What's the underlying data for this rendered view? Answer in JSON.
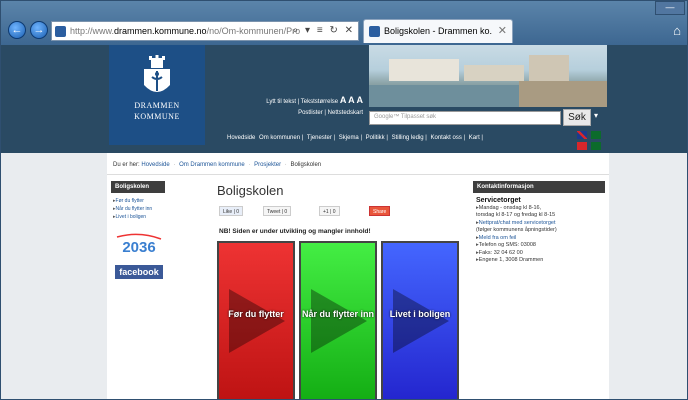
{
  "browser": {
    "url_prefix": "http://www.",
    "url_domain": "drammen.kommune.no",
    "url_rest": "/no/Om-kommunen/Pro",
    "address_tools": "⌕ ▾ ≡ ↻ ✕",
    "tab_title": "Boligskolen - Drammen ko...",
    "tab_close": "✕",
    "back_label": "←",
    "forward_label": "→",
    "home_label": "⌂",
    "window_btn": "—"
  },
  "header": {
    "logo_line1": "DRAMMEN",
    "logo_line2": "KOMMUNE",
    "util_line1_a": "Lytt til tekst | Tekststørrelse",
    "util_line1_b": "A A A",
    "util_line2": "Postlister | Nettstedskart",
    "search_placeholder": "Google™ Tilpasset søk",
    "search_button": "Søk",
    "search_dropdown": "▾",
    "nav": [
      "Hovedside",
      "Om kommunen |",
      "Tjenester |",
      "Skjema |",
      "Politikk |",
      "Stilling ledig |",
      "Kontakt oss |",
      "Kart |"
    ]
  },
  "breadcrumb": {
    "prefix": "Du er her:",
    "items": [
      "Hovedside",
      "Om Drammen kommune",
      "Prosjekter",
      "Boligskolen"
    ],
    "separator": "·"
  },
  "left": {
    "heading": "Boligskolen",
    "links": [
      "Før du flytter",
      "Når du flytter inn",
      "Livet i boligen"
    ],
    "logo_2036": "2036",
    "facebook": "facebook"
  },
  "main": {
    "title": "Boligskolen",
    "share": {
      "like": "Like",
      "like_count": "0",
      "tweet": "Tweet",
      "tweet_count": "0",
      "plus": "+1",
      "plus_count": "0",
      "share": "Share"
    },
    "notice": "NB! Siden er under utvikling og mangler innhold!",
    "tiles": [
      {
        "label": "Før du flytter",
        "color": "#d22222"
      },
      {
        "label": "Når du flytter inn",
        "color": "#33cc33"
      },
      {
        "label": "Livet i boligen",
        "color": "#3333dd"
      }
    ]
  },
  "right": {
    "heading": "Kontaktinformasjon",
    "service": "Servicetorget",
    "hours1": "Mandag - onsdag kl 8-16,",
    "hours2": "torsdag kl 8-17 og fredag kl 8-15",
    "chat1": "Nettprat/chat med servicetorget",
    "chat2": "(følger kommunens åpningstider)",
    "report": "Meld fra om feil",
    "phone": "Telefon og SMS: 03008",
    "fax": "Faks: 32 04 62 00",
    "address": "Engene 1,  3008 Drammen"
  },
  "colors": {
    "header_bg": "#2a4a63",
    "logo_bg": "#1d4f86",
    "link": "#1d5598"
  }
}
